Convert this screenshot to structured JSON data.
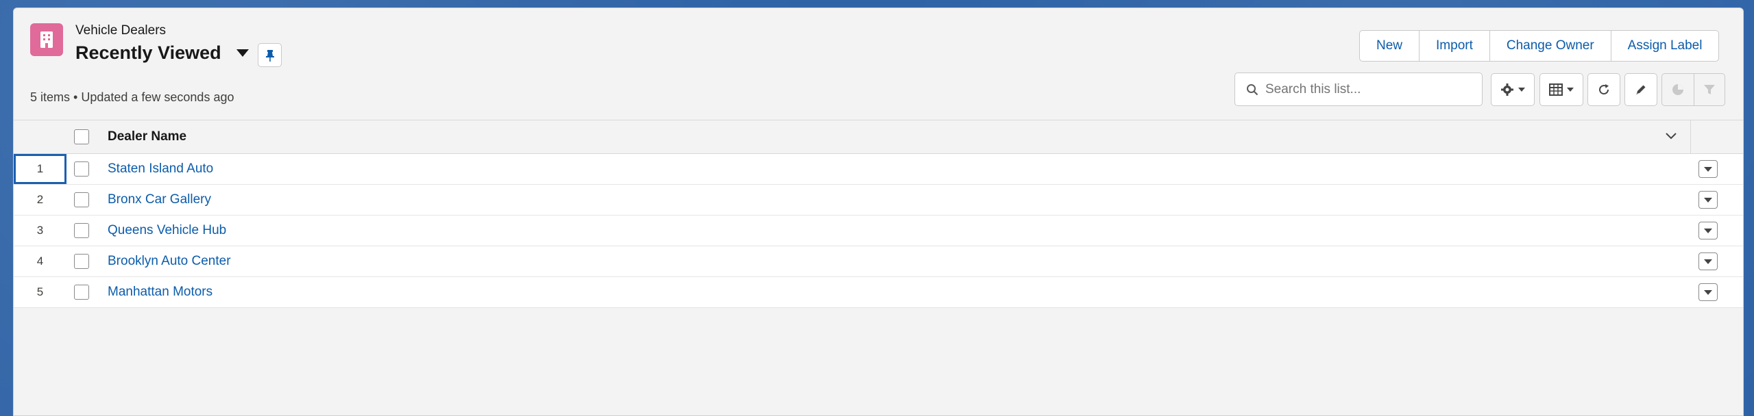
{
  "header": {
    "object_label": "Vehicle Dealers",
    "list_view_title": "Recently Viewed",
    "meta_text": "5 items • Updated a few seconds ago",
    "icon": "building-icon",
    "icon_color": "#e06a9a"
  },
  "actions": {
    "new_label": "New",
    "import_label": "Import",
    "change_owner_label": "Change Owner",
    "assign_label_label": "Assign Label"
  },
  "search": {
    "placeholder": "Search this list..."
  },
  "toolbar": {
    "settings_icon": "gear-icon",
    "display_as_icon": "table-icon",
    "refresh_icon": "refresh-icon",
    "edit_icon": "pencil-icon",
    "charts_icon": "pie-chart-icon",
    "filter_icon": "filter-icon"
  },
  "table": {
    "column_header": "Dealer Name",
    "rows": [
      {
        "num": "1",
        "name": "Staten Island Auto"
      },
      {
        "num": "2",
        "name": "Bronx Car Gallery"
      },
      {
        "num": "3",
        "name": "Queens Vehicle Hub"
      },
      {
        "num": "4",
        "name": "Brooklyn Auto Center"
      },
      {
        "num": "5",
        "name": "Manhattan Motors"
      }
    ]
  },
  "colors": {
    "link": "#0b5cab",
    "background_brand": "#2f63a6"
  }
}
